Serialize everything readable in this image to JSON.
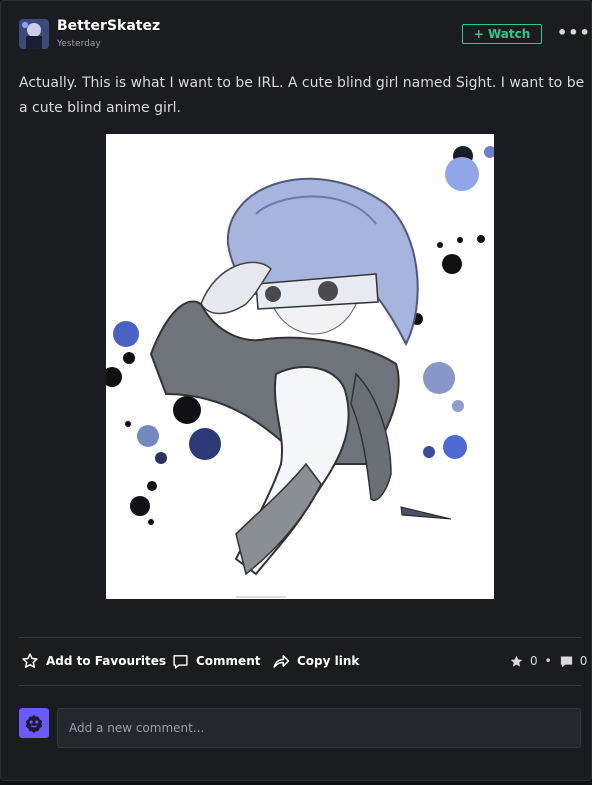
{
  "post": {
    "author": "BetterSkatez",
    "time": "Yesterday",
    "watch_label": "+ Watch",
    "more_label": "•••",
    "text": "Actually. This is what I want to be IRL. A cute blind girl named Sight. I want to be a cute blind anime girl."
  },
  "actions": {
    "favourite_label": "Add to Favourites",
    "comment_label": "Comment",
    "copy_link_label": "Copy link"
  },
  "stats": {
    "favourites": "0",
    "separator": "•",
    "comments": "0"
  },
  "comment_box": {
    "placeholder": "Add a new comment..."
  },
  "colors": {
    "accent_green": "#2dc98a",
    "card_bg": "#1a1c1f",
    "comment_avatar": "#6a5af9"
  },
  "icons": {
    "favourite": "star-outline-icon",
    "comment": "speech-bubble-icon",
    "copy_link": "share-arrow-icon",
    "favourites_count": "star-filled-icon",
    "comments_count": "comment-filled-icon"
  }
}
